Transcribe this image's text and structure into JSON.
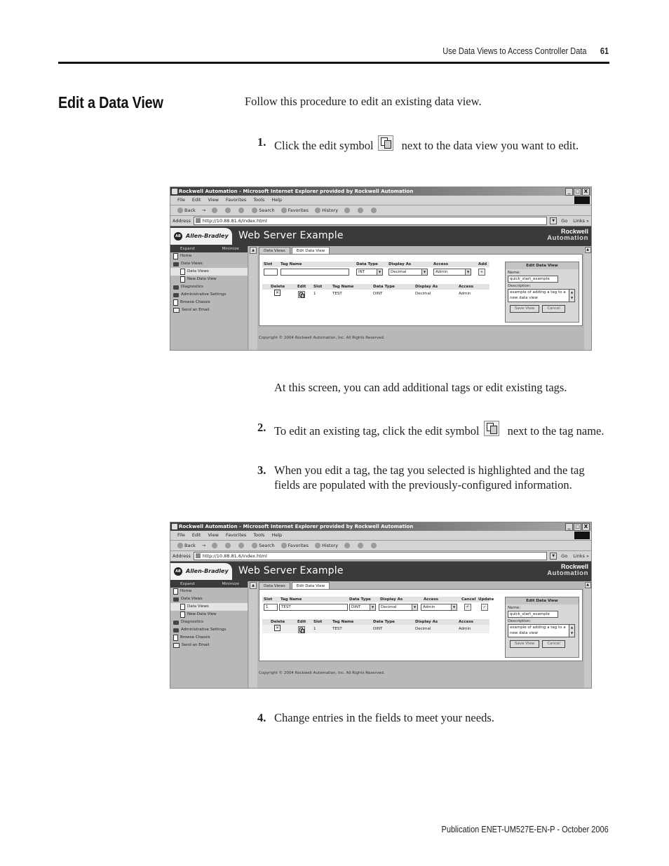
{
  "running_head": {
    "title": "Use Data Views to Access Controller Data",
    "page_number": "61"
  },
  "section_title": "Edit a Data View",
  "intro": "Follow this procedure to edit an existing data view.",
  "steps": [
    {
      "num": "1.",
      "before": "Click the edit symbol",
      "after": "next to the data view you want to edit.",
      "icon": "edit-icon"
    },
    {
      "num": "2.",
      "before": "To edit an existing tag, click the edit symbol",
      "after": "next to the tag name.",
      "icon": "edit-icon"
    },
    {
      "num": "3.",
      "text": "When you edit a tag, the tag you selected is highlighted and the tag fields are populated with the previously-configured information."
    },
    {
      "num": "4.",
      "text": "Change entries in the fields to meet your needs."
    }
  ],
  "between_text": "At this screen, you can add additional tags or edit existing tags.",
  "footer": "Publication ENET-UM527E-EN-P - October 2006",
  "browser": {
    "title": "Rockwell Automation - Microsoft Internet Explorer provided by Rockwell Automation",
    "window_buttons": [
      "_",
      "□",
      "X"
    ],
    "menu": [
      "File",
      "Edit",
      "View",
      "Favorites",
      "Tools",
      "Help"
    ],
    "toolbar": [
      "Back",
      "→",
      "Stop",
      "Refresh",
      "Home",
      "Search",
      "Favorites",
      "History",
      "Mail",
      "Print",
      "Edit"
    ],
    "address_label": "Address",
    "address_url": "http://10.88.81.6/index.html",
    "go_label": "Go",
    "links_label": "Links »"
  },
  "site": {
    "brand": "Allen-Bradley",
    "title": "Web Server Example",
    "corp_line1": "Rockwell",
    "corp_line2": "Automation",
    "sidebar_head": {
      "expand": "Expand",
      "minimize": "Minimize"
    },
    "sidebar": [
      {
        "label": "Home",
        "icon": "doc",
        "level": 0
      },
      {
        "label": "Data Views",
        "icon": "folder-open",
        "level": 0
      },
      {
        "label": "Data Views",
        "icon": "doc",
        "level": 1,
        "active": true
      },
      {
        "label": "New Data View",
        "icon": "doc",
        "level": 1
      },
      {
        "label": "Diagnostics",
        "icon": "folder",
        "level": 0
      },
      {
        "label": "Administrative Settings",
        "icon": "folder",
        "level": 0
      },
      {
        "label": "Browse Chassis",
        "icon": "doc",
        "level": 0
      },
      {
        "label": "Send an Email",
        "icon": "mail",
        "level": 0
      }
    ],
    "tabs": [
      "Data Views",
      "Edit Data View"
    ],
    "form_headers": {
      "slot": "Slot",
      "tag_name": "Tag Name",
      "data_type": "Data Type",
      "display_as": "Display As",
      "access": "Access",
      "add": "Add",
      "cancel": "Cancel",
      "update": "Update"
    },
    "table_headers": [
      "Delete",
      "Edit",
      "Slot",
      "Tag Name",
      "Data Type",
      "Display As",
      "Access"
    ],
    "table_rows": [
      {
        "slot": "1",
        "tag_name": "TEST",
        "data_type": "DINT",
        "display_as": "Decimal",
        "access": "Admin"
      }
    ],
    "edit_panel": {
      "title": "Edit Data View",
      "name_label": "Name:",
      "name_value": "quick_start_example",
      "desc_label": "Description:",
      "desc_value": "example of adding a tag to a new data view",
      "save": "Save View",
      "cancel": "Cancel"
    },
    "copyright": "Copyright © 2004 Rockwell Automation, Inc. All Rights Reserved."
  },
  "screenshot1_form": {
    "slot": "",
    "tag_name": "",
    "data_type": "INT",
    "display_as": "Decimal",
    "access": "Admin"
  },
  "screenshot2_form": {
    "slot": "1",
    "tag_name": "TEST",
    "data_type": "DINT",
    "display_as": "Decimal",
    "access": "Admin"
  }
}
